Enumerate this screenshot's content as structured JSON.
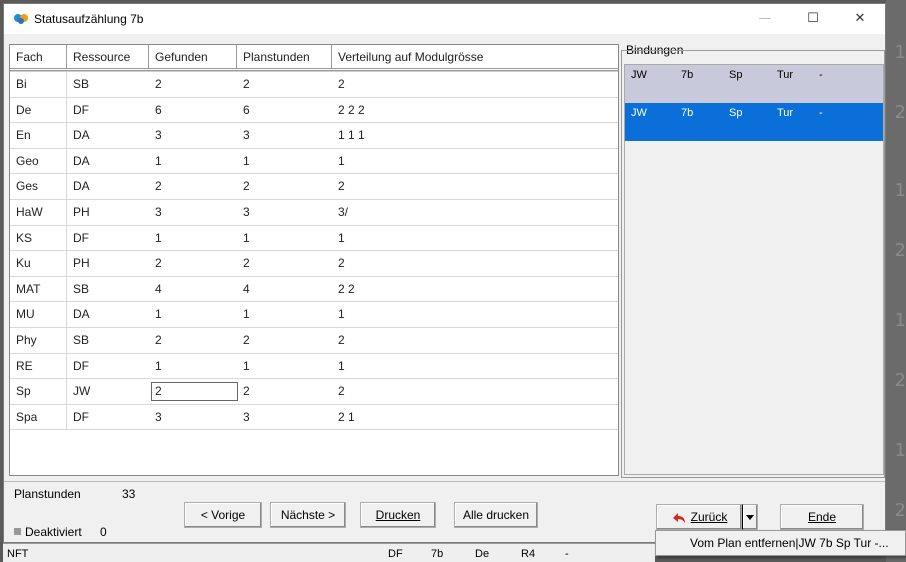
{
  "window": {
    "title": "Statusaufzählung 7b",
    "minimize": "—",
    "maximize": "☐",
    "close": "✕"
  },
  "grid": {
    "columns": [
      "Fach",
      "Ressource",
      "Gefunden",
      "Planstunden",
      "Verteilung auf Modulgrösse"
    ],
    "rows": [
      [
        "Bi",
        "SB",
        "2",
        "2",
        "2"
      ],
      [
        "De",
        "DF",
        "6",
        "6",
        "2   2   2"
      ],
      [
        "En",
        "DA",
        "3",
        "3",
        "1   1   1"
      ],
      [
        "Geo",
        "DA",
        "1",
        "1",
        "1"
      ],
      [
        "Ges",
        "DA",
        "2",
        "2",
        "2"
      ],
      [
        "HaW",
        "PH",
        "3",
        "3",
        "3/"
      ],
      [
        "KS",
        "DF",
        "1",
        "1",
        "1"
      ],
      [
        "Ku",
        "PH",
        "2",
        "2",
        "2"
      ],
      [
        "MAT",
        "SB",
        "4",
        "4",
        "2   2"
      ],
      [
        "MU",
        "DA",
        "1",
        "1",
        "1"
      ],
      [
        "Phy",
        "SB",
        "2",
        "2",
        "2"
      ],
      [
        "RE",
        "DF",
        "1",
        "1",
        "1"
      ],
      [
        "Sp",
        "JW",
        "2",
        "2",
        "2"
      ],
      [
        "Spa",
        "DF",
        "3",
        "3",
        "2   1"
      ]
    ]
  },
  "bindings": {
    "label": "Bindungen",
    "items": [
      {
        "teacher": "JW",
        "class": "7b",
        "subject": "Sp",
        "room": "Tur",
        "extra": "-"
      },
      {
        "teacher": "JW",
        "class": "7b",
        "subject": "Sp",
        "room": "Tur",
        "extra": "-"
      }
    ]
  },
  "footer": {
    "planstunden_label": "Planstunden",
    "planstunden_value": "33",
    "deaktiviert_label": "Deaktiviert",
    "deaktiviert_value": "0",
    "btn_prev": "< Vorige",
    "btn_next": "Nächste >",
    "btn_print": "Drucken",
    "btn_print_all": "Alle drucken",
    "btn_back": "Zurück",
    "btn_end": "Ende",
    "popup_item": "Vom Plan entfernen|JW 7b Sp Tur -..."
  },
  "background": {
    "row_text": [
      "NFT",
      "DF",
      "7b",
      "De",
      "R4",
      "-"
    ],
    "right_digits": [
      "1",
      "2",
      "1",
      "2",
      "1",
      "2",
      "1",
      "2"
    ]
  }
}
